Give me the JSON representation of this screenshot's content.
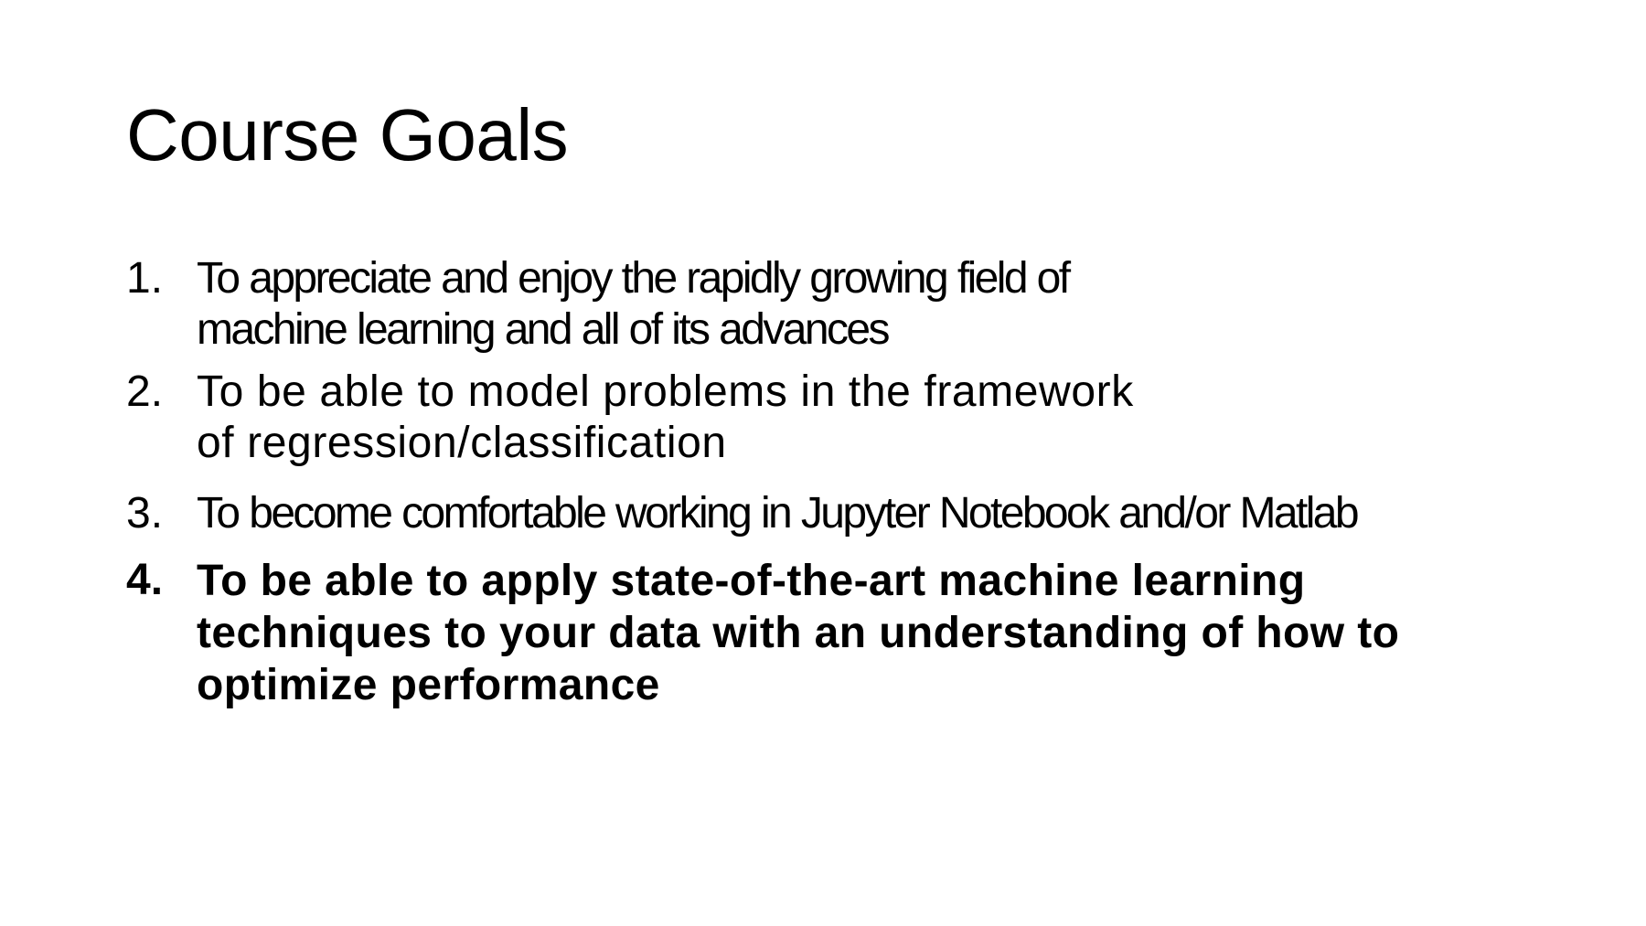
{
  "slide": {
    "title": "Course Goals",
    "goals": [
      {
        "number": "1.",
        "text": "To appreciate and enjoy the rapidly growing field of\nmachine learning and all of its advances"
      },
      {
        "number": "2.",
        "text": "To be able to model problems in the framework\nof regression/classification"
      },
      {
        "number": "3.",
        "text": "To become comfortable working in Jupyter Notebook and/or Matlab"
      },
      {
        "number": "4.",
        "text": "To be able to apply state-of-the-art machine learning\ntechniques to your data with an understanding of how to\noptimize performance"
      }
    ]
  }
}
